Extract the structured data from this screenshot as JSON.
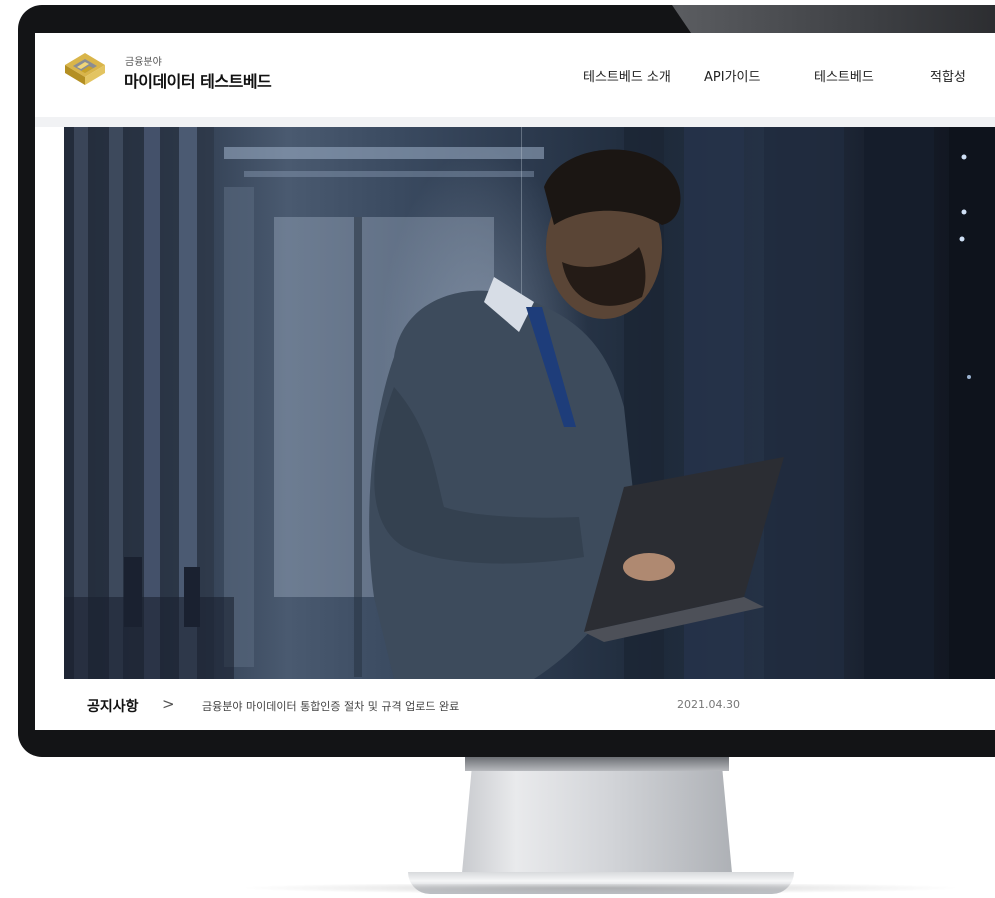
{
  "brand": {
    "small_label": "금융분야",
    "main_label": "마이데이터 테스트베드"
  },
  "nav": {
    "items": [
      "테스트베드 소개",
      "API가이드",
      "테스트베드",
      "적합성"
    ]
  },
  "notice": {
    "title": "공지사항",
    "arrow": ">",
    "text": "금융분야 마이데이터 통합인증 절차 및 규격 업로드 완료",
    "date": "2021.04.30"
  },
  "colors": {
    "logo_gold": "#c9a227",
    "logo_gray": "#7b7f86",
    "frame": "#131416"
  },
  "icons": {
    "logo": "brand-logo-icon",
    "arrow": "chevron-right-icon"
  }
}
